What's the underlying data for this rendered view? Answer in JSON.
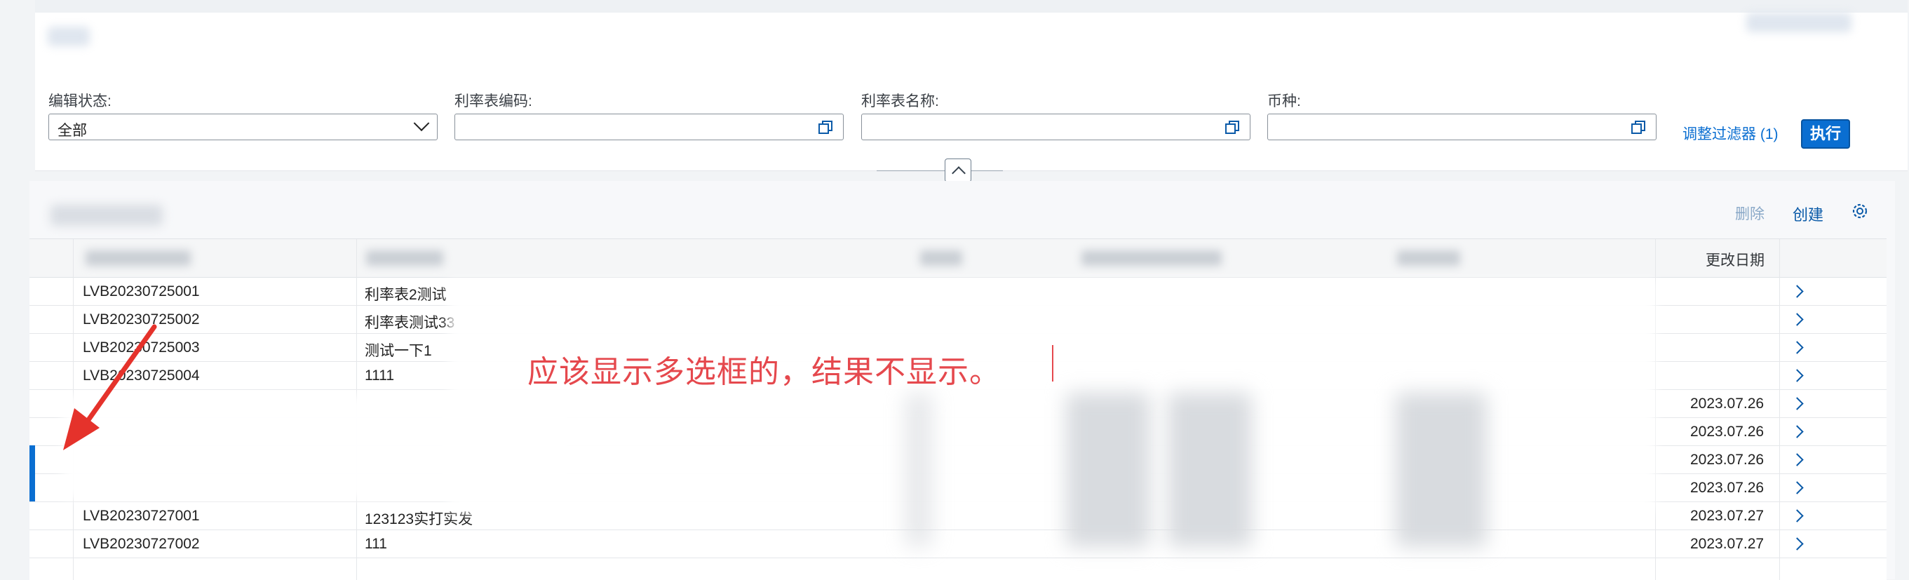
{
  "filters": {
    "edit_status": {
      "label": "编辑状态:",
      "value": "全部"
    },
    "rate_code": {
      "label": "利率表编码:",
      "value": ""
    },
    "rate_name": {
      "label": "利率表名称:",
      "value": ""
    },
    "currency": {
      "label": "币种:",
      "value": ""
    },
    "adjust_filters": "调整过滤器 (1)",
    "go": "执行"
  },
  "toolbar": {
    "delete": "删除",
    "create": "创建"
  },
  "table": {
    "columns": {
      "change_date": "更改日期"
    },
    "rows": [
      {
        "id": "LVB20230725001",
        "name": "利率表2测试",
        "date": ""
      },
      {
        "id": "LVB20230725002",
        "name": "利率表测试33",
        "date": ""
      },
      {
        "id": "LVB20230725003",
        "name": "测试一下1",
        "date": ""
      },
      {
        "id": "LVB20230725004",
        "name": "1111",
        "date": ""
      },
      {
        "id": "",
        "name": "",
        "date": "2023.07.26"
      },
      {
        "id": "",
        "name": "",
        "date": "2023.07.26"
      },
      {
        "id": "",
        "name": "",
        "date": "2023.07.26"
      },
      {
        "id": "",
        "name": "",
        "date": "2023.07.26"
      },
      {
        "id": "LVB20230727001",
        "name": "123123实打实发",
        "date": "2023.07.27"
      },
      {
        "id": "LVB20230727002",
        "name": "111",
        "date": "2023.07.27"
      }
    ]
  },
  "annotation": "应该显示多选框的，结果不显示。",
  "colors": {
    "accent": "#0a6ed1",
    "annotation": "#e5484d"
  },
  "icons": [
    "chevron-down-icon",
    "value-help-icon",
    "chevron-up-icon",
    "gear-icon",
    "chevron-right-icon",
    "arrow-icon"
  ]
}
